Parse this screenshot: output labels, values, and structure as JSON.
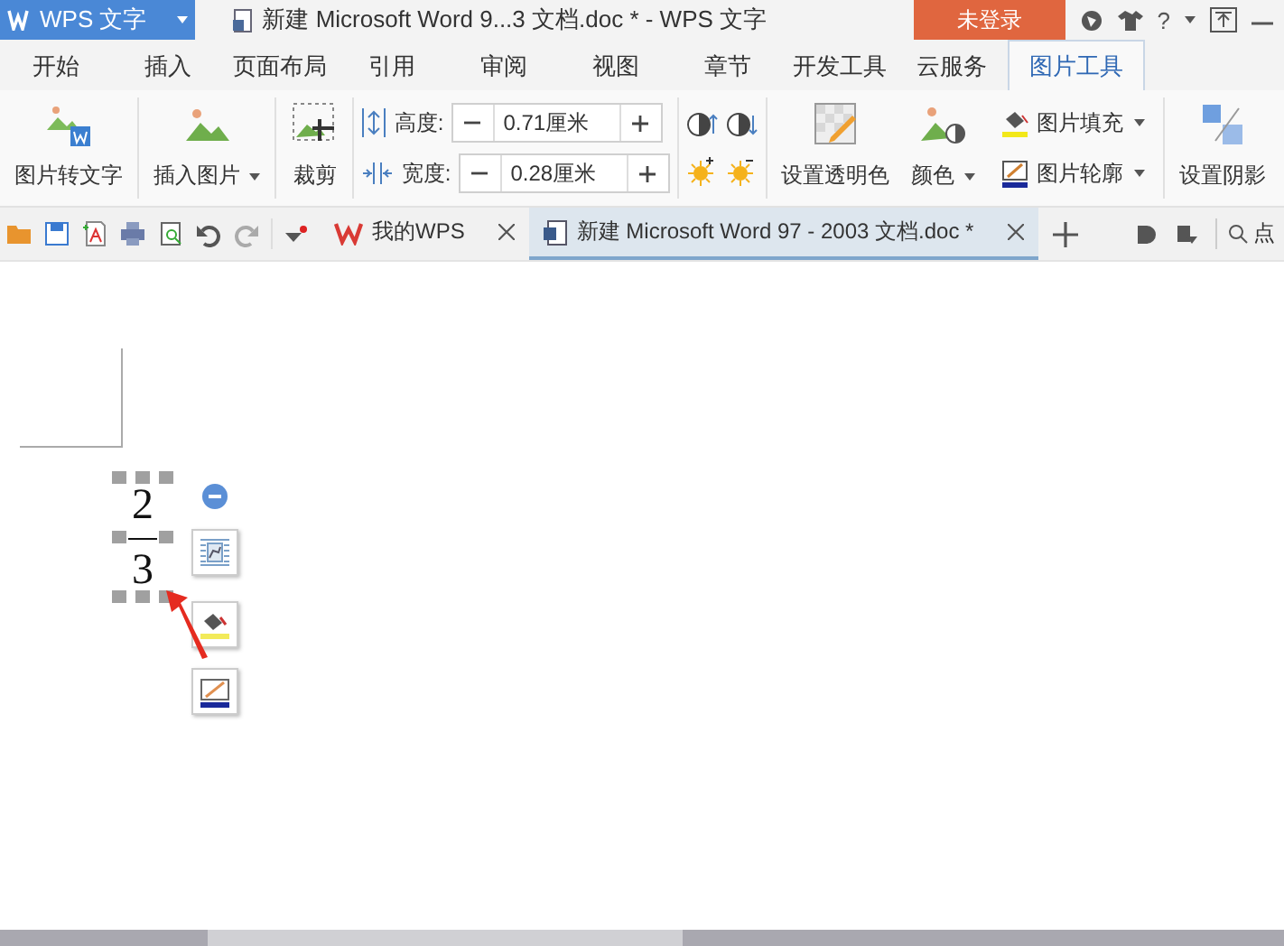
{
  "app_menu": {
    "label": "WPS 文字"
  },
  "window": {
    "title": "新建 Microsoft Word 9...3 文档.doc * - WPS 文字"
  },
  "login_button": {
    "label": "未登录"
  },
  "help_button": {
    "label": "?"
  },
  "ribbon_tabs": [
    {
      "label": "开始",
      "selected": false
    },
    {
      "label": "插入",
      "selected": false
    },
    {
      "label": "页面布局",
      "selected": false
    },
    {
      "label": "引用",
      "selected": false
    },
    {
      "label": "审阅",
      "selected": false
    },
    {
      "label": "视图",
      "selected": false
    },
    {
      "label": "章节",
      "selected": false
    },
    {
      "label": "开发工具",
      "selected": false
    },
    {
      "label": "云服务",
      "selected": false
    },
    {
      "label": "图片工具",
      "selected": true
    }
  ],
  "ribbon": {
    "picture_to_text": "图片转文字",
    "insert_picture": "插入图片",
    "crop": "裁剪",
    "height": {
      "label": "高度:",
      "value": "0.71厘米"
    },
    "width": {
      "label": "宽度:",
      "value": "0.28厘米"
    },
    "set_transparent": "设置透明色",
    "color_button": "颜色",
    "picture_fill": "图片填充",
    "picture_outline": "图片轮廓",
    "set_shadow": "设置阴影"
  },
  "doc_tabs": [
    {
      "label": "我的WPS",
      "selected": false
    },
    {
      "label": "新建 Microsoft Word 97 - 2003 文档.doc *",
      "selected": true
    }
  ],
  "search": {
    "label": "点"
  },
  "document": {
    "fraction": {
      "numerator": "2",
      "denominator": "3",
      "selected": true
    }
  }
}
